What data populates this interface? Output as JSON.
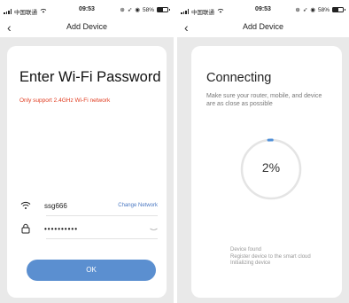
{
  "status_bar": {
    "carrier": "中国联通",
    "time": "09:53",
    "battery_text": "58%",
    "battery_level": 0.58
  },
  "add_wifi_screen": {
    "nav_title": "Add Device",
    "title": "Enter Wi-Fi Password",
    "warning": "Only support 2.4GHz Wi-Fi network",
    "network_name": "ssg666",
    "change_network_label": "Change Network",
    "password_masked": "••••••••••",
    "ok_label": "OK"
  },
  "connecting_screen": {
    "nav_title": "Add Device",
    "title": "Connecting",
    "description": "Make sure your router, mobile, and device are as close as possible",
    "progress_text": "2%",
    "progress_value": 0.02,
    "steps": [
      "Device found",
      "Register device to the smart cloud",
      "Initializing device"
    ]
  },
  "colors": {
    "accent": "#5b8fd0",
    "warning": "#e03c20",
    "link": "#4a78c2",
    "card_background": "#e9e9e9"
  }
}
